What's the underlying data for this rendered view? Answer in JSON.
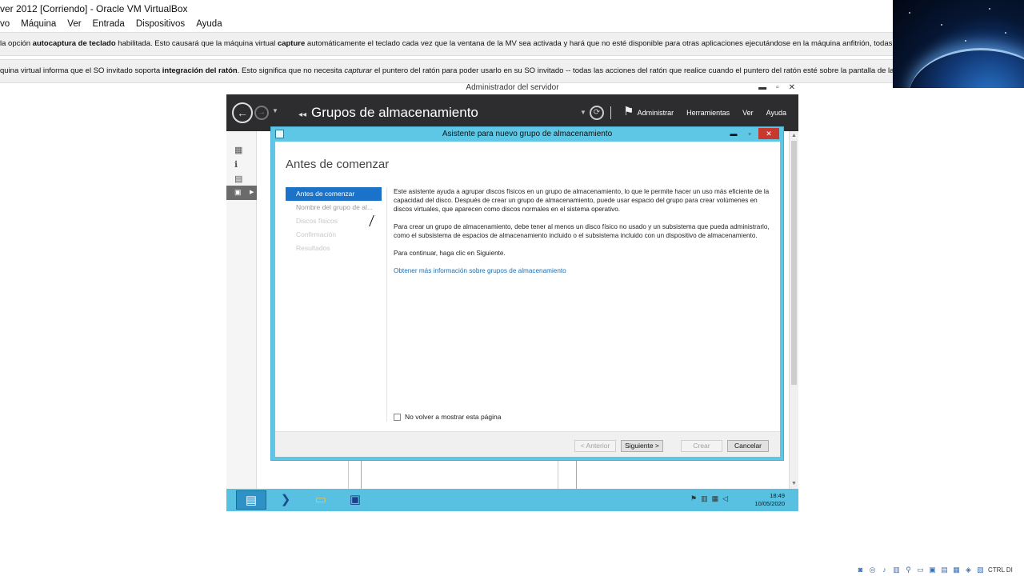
{
  "host": {
    "title": "ver 2012 [Corriendo] - Oracle VM VirtualBox",
    "menu": [
      "vo",
      "Máquina",
      "Ver",
      "Entrada",
      "Dispositivos",
      "Ayuda"
    ],
    "notice1": {
      "pre": "la opción ",
      "bold1": "autocaptura de teclado",
      "mid": " habilitada. Esto causará que la máquina virtual ",
      "bold2": "capture",
      "post": " automáticamente el teclado cada vez que la ventana de la MV sea activada y hará que no esté disponible para otras aplicaciones ejecutándose en la máquina anfitrión, todas las combi"
    },
    "notice2": {
      "pre": "quina virtual informa que el SO invitado soporta ",
      "bold": "integración del ratón",
      "mid": ". Esto significa que no necesita ",
      "italic": "capturar",
      "post": " el puntero del ratón para poder usarlo en su SO invitado -- todas las acciones del ratón que realice cuando el puntero del ratón esté sobre la pantalla de la máquina v"
    },
    "host_key": "CTRL DI"
  },
  "server_manager": {
    "window_title": "Administrador del servidor",
    "page_title": "Grupos de almacenamiento",
    "menus": [
      "Administrar",
      "Herramientas",
      "Ver",
      "Ayuda"
    ]
  },
  "wizard": {
    "title": "Asistente para nuevo grupo de almacenamiento",
    "heading": "Antes de comenzar",
    "steps": [
      "Antes de comenzar",
      "Nombre del grupo de al...",
      "Discos físicos",
      "Confirmación",
      "Resultados"
    ],
    "paragraph1": "Este asistente ayuda a agrupar discos físicos en un grupo de almacenamiento, lo que le permite hacer un uso más eficiente de la capacidad del disco. Después de crear un grupo de almacenamiento, puede usar espacio del grupo para crear volúmenes en discos virtuales, que aparecen como discos normales en el sistema operativo.",
    "paragraph2": "Para crear un grupo de almacenamiento, debe tener al menos un disco físico no usado y un subsistema que pueda administrarlo, como el subsistema de espacios de almacenamiento incluido o el subsistema incluido con un dispositivo de almacenamiento.",
    "paragraph3": "Para continuar, haga clic en Siguiente.",
    "link": "Obtener más información sobre grupos de almacenamiento",
    "checkbox_label": "No volver a mostrar esta página",
    "buttons": {
      "prev": "< Anterior",
      "next": "Siguiente >",
      "create": "Crear",
      "cancel": "Cancelar"
    }
  },
  "taskbar": {
    "time": "18:49",
    "date": "10/05/2020"
  }
}
